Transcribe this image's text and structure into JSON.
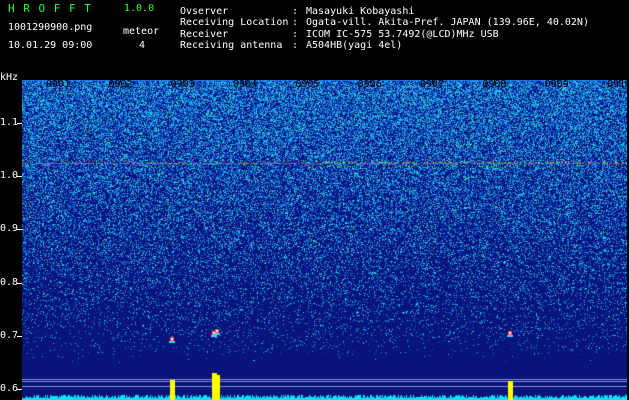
{
  "header": {
    "app_name": "H R O F F T",
    "version": "1.0.0",
    "filename": "1001290900.png",
    "datetime": "10.01.29 09:00",
    "meteor_label": "meteor",
    "meteor_count": "4",
    "info": [
      {
        "label": "Ovserver",
        "sep": ":",
        "value": "Masayuki Kobayashi"
      },
      {
        "label": "Receiving Location",
        "sep": ":",
        "value": "Ogata-vill. Akita-Pref. JAPAN (139.96E, 40.02N)"
      },
      {
        "label": "Receiver",
        "sep": ":",
        "value": "ICOM IC-575 53.7492(@LCD)MHz USB"
      },
      {
        "label": "Receiving antenna",
        "sep": ":",
        "value": "A504HB(yagi 4el)"
      }
    ]
  },
  "colors": {
    "header_text": "#ffffff",
    "app_name": "#22ff22",
    "background": "#000000",
    "spectrogram_base": "#0a1e8c",
    "noise_bright": "#3cc8ff",
    "tone_line": "#ff3c3c",
    "baseline": "#00e5ff",
    "meteor": "#ffff00"
  },
  "chart_data": {
    "type": "heatmap",
    "ylabel": "kHz",
    "x_tick_labels": [
      "0901",
      "0902",
      "0903",
      "0904",
      "0905",
      "0906",
      "0907",
      "0908",
      "0909",
      "0910"
    ],
    "y_tick_labels": [
      "1.1",
      "1.0",
      "0.9",
      "0.8",
      "0.7",
      "0.6"
    ],
    "x_range_minutes": [
      0,
      10
    ],
    "y_range_khz": [
      0.58,
      1.18
    ],
    "carrier_khz": 1.025,
    "meteors": [
      {
        "minute": 2.83,
        "khz": 0.695
      },
      {
        "minute": 3.5,
        "khz": 0.705
      },
      {
        "minute": 3.55,
        "khz": 0.71
      },
      {
        "minute": 8.25,
        "khz": 0.705
      }
    ]
  }
}
